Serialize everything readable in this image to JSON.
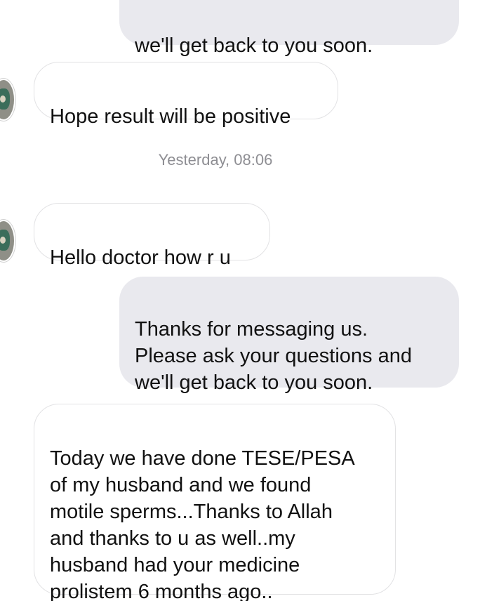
{
  "messages": [
    {
      "sender": "business",
      "text": "we'll get back to you soon."
    },
    {
      "sender": "user",
      "text": "Hope result will be positive"
    },
    {
      "sender": "user",
      "text": "Hello doctor how r u"
    },
    {
      "sender": "business",
      "text": "Thanks for messaging us.\nPlease ask your questions and\nwe'll get back to you soon."
    },
    {
      "sender": "user",
      "text": "Today we have done TESE/PESA\nof my husband and we found\nmotile sperms...Thanks to Allah\nand thanks to u as well..my\nhusband had your medicine\nprolistem 6 months ago.."
    }
  ],
  "timestamp": "Yesterday, 08:06",
  "colors": {
    "incoming_bubble": "#ffffff",
    "incoming_border": "#e2e2e4",
    "outgoing_bubble": "#e9e9ee",
    "timestamp_text": "#8e8e93"
  },
  "icons": {
    "avatar": "avatar-icon"
  }
}
